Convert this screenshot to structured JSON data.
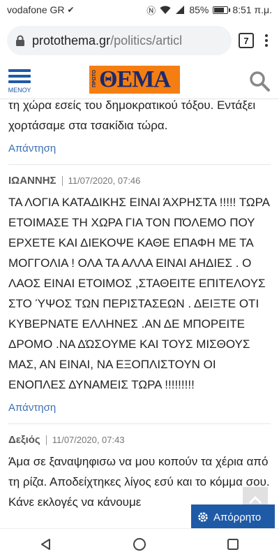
{
  "status": {
    "carrier": "vodafone GR",
    "battery_pct": "85%",
    "battery_level": 0.85,
    "time": "8:51 π.μ."
  },
  "browser": {
    "url_host": "protothema.gr",
    "url_path": "/politics/articl",
    "tab_count": "7"
  },
  "site": {
    "menu_label": "ΜΕΝΟΥ",
    "logo_text": "ΘΕΜΑ",
    "logo_prefix": "ΠΡΩΤΟ",
    "brand_color": "#f57e13",
    "accent_color": "#1f5aa6"
  },
  "comments": [
    {
      "author": "",
      "date": "",
      "text": "τη χώρα εσείς του δημοκρατικού τόξου. Εντάξει χορτάσαμε στα τσακίδια τώρα.",
      "reply_label": "Απάντηση"
    },
    {
      "author": "ΙΩΑΝΝΗΣ",
      "date": "11/07/2020, 07:46",
      "text": "ΤΑ ΛΟΓΙΑ ΚΑΤΑΔΙΚΗΣ ΕΙΝΑΙ ΆΧΡΗΣΤΑ !!!!! ΤΩΡΑ ΕΤΟΙΜΑΣΕ ΤΗ ΧΩΡΑ ΓΙΑ ΤΟΝ ΠΌΛΕΜΟ ΠΟΥ ΕΡΧΕΤΕ ΚΑΙ ΔΙΕΚΟΨΕ ΚΑΘΕ ΕΠΑΦΗ ΜΕ ΤΑ ΜΟΓΓΟΛΙΑ ! ΟΛΑ ΤΑ ΑΛΛΑ ΕΙΝΑΙ ΑΗΔΙΕΣ . Ο ΛΑΟΣ ΕΙΝΑΙ ΕΤΟΙΜΟΣ ,ΣΤΑΘΕΙΤΕ ΕΠΙΤΕΛΟΥΣ ΣΤΟ ΎΨΟΣ ΤΩΝ ΠΕΡΙΣΤΑΣΕΩΝ . ΔΕΙΞΤΕ ΟΤΙ ΚΥΒΕΡΝΑΤΕ ΕΛΛΗΝΕΣ .ΑΝ ΔΕ ΜΠΟΡΕΙΤΕ ΔΡΟΜΟ .ΝΑ ΔΏΣΟΥΜΕ ΚΑΙ ΤΟΥΣ ΜΙΣΘΟΥΣ ΜΑΣ, ΑΝ ΕΙΝΑΙ, ΝΑ ΕΞΟΠΛΙΣΤΟΥΝ ΟΙ ΕΝΟΠΛΕΣ ΔΥΝΑΜΕΙΣ ΤΩΡΑ !!!!!!!!!",
      "reply_label": "Απάντηση"
    },
    {
      "author": "Δεξιός",
      "date": "11/07/2020, 07:43",
      "text": "Άμα σε ξαναψηφισω να μου κοπούν τα χέρια από τη ρίζα. Αποδείχτηκες λίγος εσύ και το κόμμα σου. Κάνε εκλογές να κάνουμε",
      "reply_label": ""
    }
  ],
  "privacy_label": "Απόρρητο",
  "icons": [
    "lock-icon",
    "search-icon",
    "menu-icon",
    "kebab-menu-icon",
    "chevron-up-icon",
    "gear-icon",
    "back-icon",
    "home-icon",
    "recents-icon"
  ]
}
